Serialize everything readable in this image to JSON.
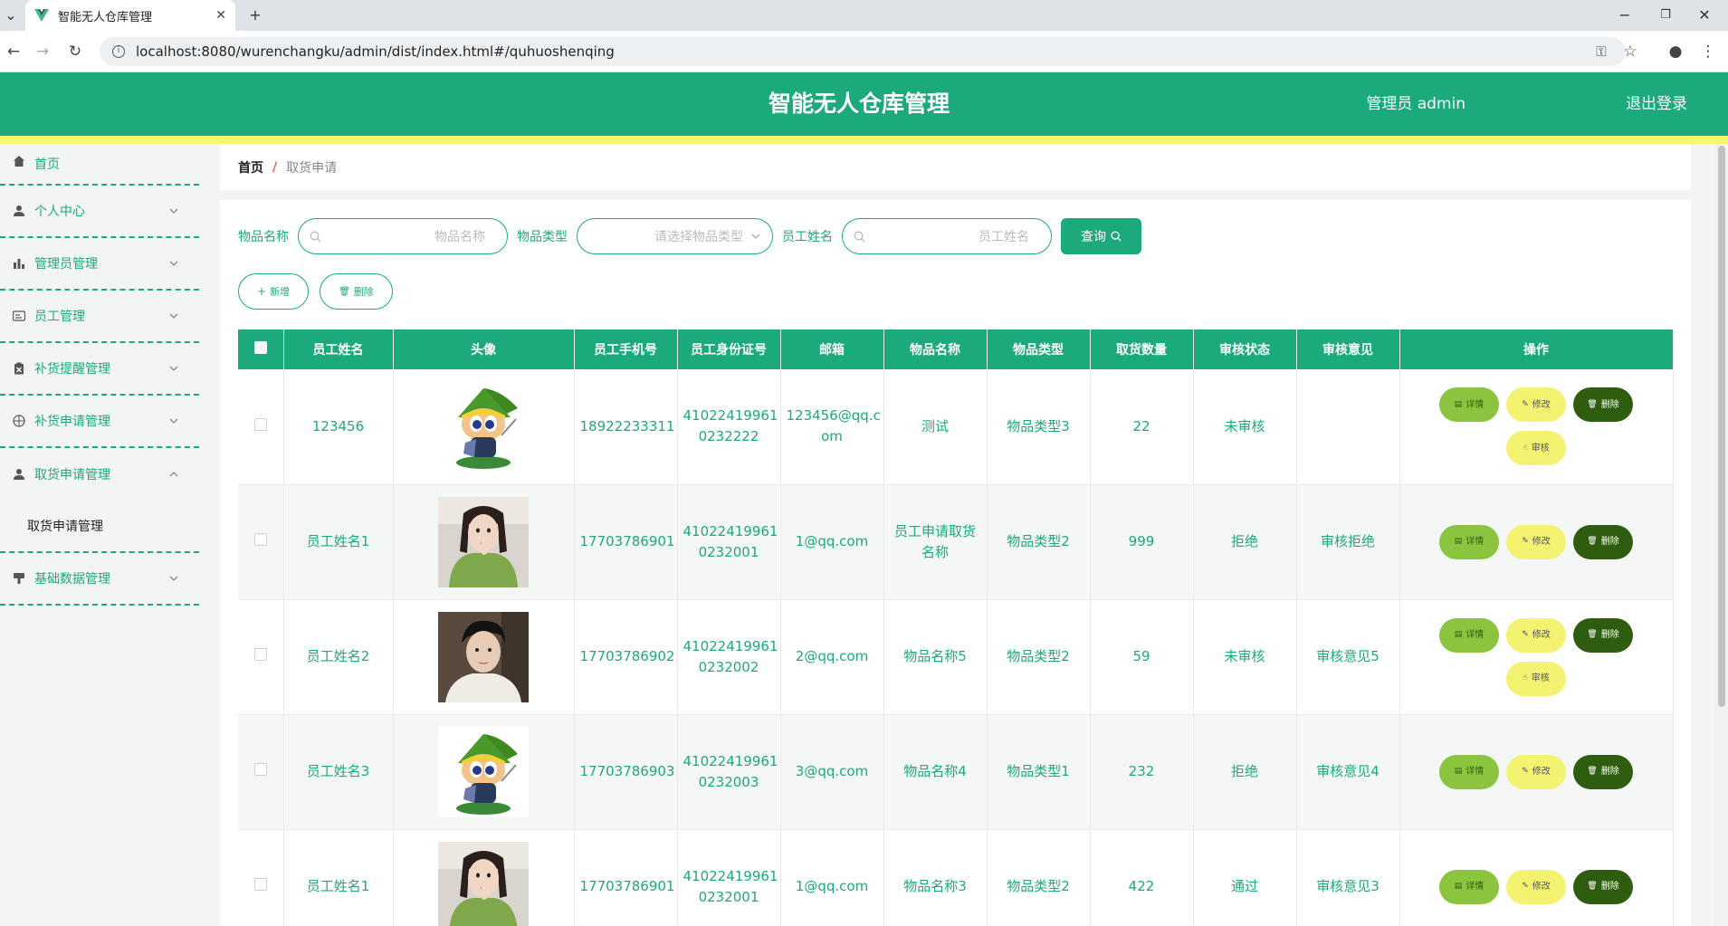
{
  "browser": {
    "tab_title": "智能无人仓库管理",
    "url": "localhost:8080/wurenchangku/admin/dist/index.html#/quhuoshenqing"
  },
  "header": {
    "title": "智能无人仓库管理",
    "user": "管理员 admin",
    "logout": "退出登录"
  },
  "sidebar": {
    "items": [
      {
        "label": "首页",
        "icon": "home-icon"
      },
      {
        "label": "个人中心",
        "icon": "person-icon"
      },
      {
        "label": "管理员管理",
        "icon": "bar-chart-icon"
      },
      {
        "label": "员工管理",
        "icon": "id-card-icon"
      },
      {
        "label": "补货提醒管理",
        "icon": "clipboard-icon"
      },
      {
        "label": "补货申请管理",
        "icon": "compass-icon"
      },
      {
        "label": "取货申请管理",
        "icon": "person-icon"
      },
      {
        "label": "基础数据管理",
        "icon": "stamp-icon"
      }
    ],
    "submenu": "取货申请管理"
  },
  "breadcrumb": {
    "home": "首页",
    "separator": "/",
    "current": "取货申请"
  },
  "search": {
    "item_name_label": "物品名称",
    "item_name_placeholder": "物品名称",
    "item_type_label": "物品类型",
    "item_type_placeholder": "请选择物品类型",
    "employee_label": "员工姓名",
    "employee_placeholder": "员工姓名",
    "query_label": "查询"
  },
  "actions": {
    "add": "新增",
    "delete": "删除"
  },
  "table": {
    "columns": [
      "员工姓名",
      "头像",
      "员工手机号",
      "员工身份证号",
      "邮箱",
      "物品名称",
      "物品类型",
      "取货数量",
      "审核状态",
      "审核意见",
      "操作"
    ],
    "op_labels": {
      "detail": "详情",
      "edit": "修改",
      "delete": "删除",
      "audit": "审核"
    },
    "rows": [
      {
        "name": "123456",
        "avatar": "cartoon",
        "phone": "18922233311",
        "id_card_a": "41022419961",
        "id_card_b": "0232222",
        "email_a": "123456@qq.c",
        "email_b": "om",
        "item": "测试",
        "item_b": "",
        "type": "物品类型3",
        "qty": "22",
        "status": "未审核",
        "opinion": "",
        "audit": true
      },
      {
        "name": "员工姓名1",
        "avatar": "girl",
        "phone": "17703786901",
        "id_card_a": "41022419961",
        "id_card_b": "0232001",
        "email_a": "1@qq.com",
        "email_b": "",
        "item": "员工申请取货",
        "item_b": "名称",
        "type": "物品类型2",
        "qty": "999",
        "status": "拒绝",
        "opinion": "审核拒绝",
        "audit": false
      },
      {
        "name": "员工姓名2",
        "avatar": "boy",
        "phone": "17703786902",
        "id_card_a": "41022419961",
        "id_card_b": "0232002",
        "email_a": "2@qq.com",
        "email_b": "",
        "item": "物品名称5",
        "item_b": "",
        "type": "物品类型2",
        "qty": "59",
        "status": "未审核",
        "opinion": "审核意见5",
        "audit": true
      },
      {
        "name": "员工姓名3",
        "avatar": "cartoon",
        "phone": "17703786903",
        "id_card_a": "41022419961",
        "id_card_b": "0232003",
        "email_a": "3@qq.com",
        "email_b": "",
        "item": "物品名称4",
        "item_b": "",
        "type": "物品类型1",
        "qty": "232",
        "status": "拒绝",
        "opinion": "审核意见4",
        "audit": false
      },
      {
        "name": "员工姓名1",
        "avatar": "girl",
        "phone": "17703786901",
        "id_card_a": "41022419961",
        "id_card_b": "0232001",
        "email_a": "1@qq.com",
        "email_b": "",
        "item": "物品名称3",
        "item_b": "",
        "type": "物品类型2",
        "qty": "422",
        "status": "通过",
        "opinion": "审核意见3",
        "audit": false
      }
    ]
  },
  "colors": {
    "primary": "#1ca97b",
    "accent_yellow": "#f7f76a",
    "detail_btn": "#8bc43e",
    "delete_btn": "#2f5d10"
  }
}
